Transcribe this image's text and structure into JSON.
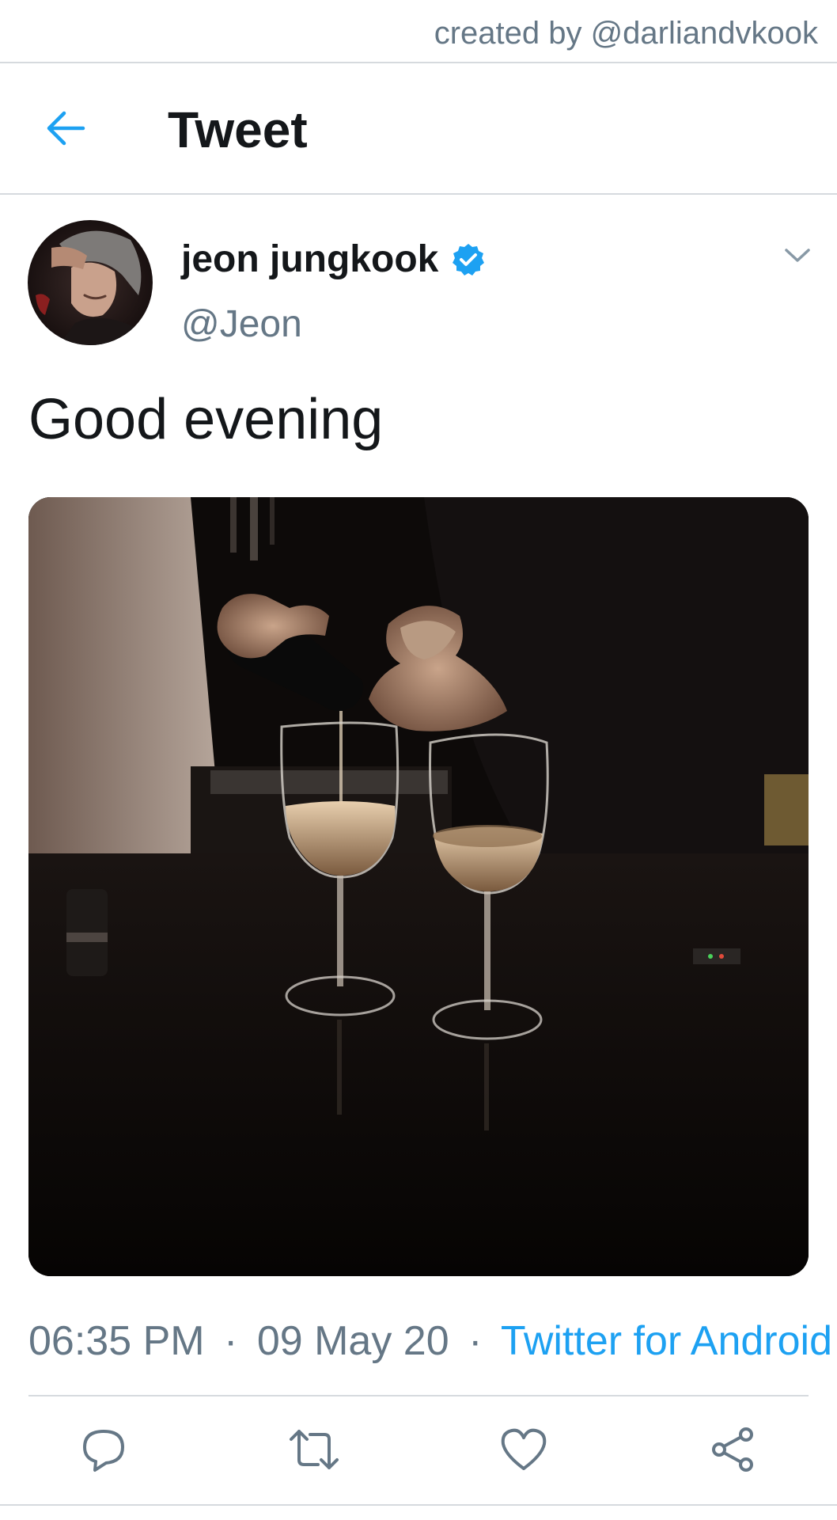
{
  "credit": {
    "text": "created by @darliandvkook"
  },
  "header": {
    "title": "Tweet",
    "back_icon": "arrow-left-icon",
    "accent_color": "#1da1f2"
  },
  "author": {
    "display_name": "jeon jungkook",
    "handle": "@Jeon",
    "verified": true,
    "verified_icon": "verified-badge-icon"
  },
  "tweet": {
    "text": "Good evening",
    "media_description_icon": "photo"
  },
  "meta": {
    "time": "06:35 PM",
    "separator": "·",
    "date": "09 May 20",
    "source": "Twitter for Android"
  },
  "actions": [
    {
      "name": "reply",
      "icon": "reply-icon"
    },
    {
      "name": "retweet",
      "icon": "retweet-icon"
    },
    {
      "name": "like",
      "icon": "heart-icon"
    },
    {
      "name": "share",
      "icon": "share-icon"
    }
  ],
  "colors": {
    "text_primary": "#14171a",
    "text_secondary": "#657786",
    "link": "#1da1f2",
    "divider": "#d6dade"
  }
}
